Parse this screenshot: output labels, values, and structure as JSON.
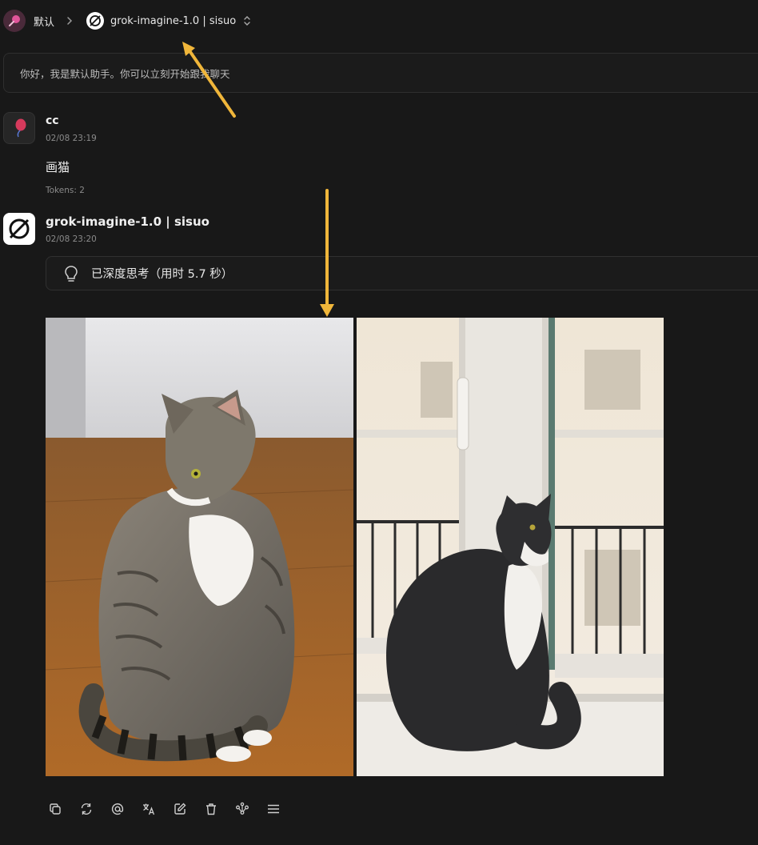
{
  "header": {
    "assistant_name": "默认",
    "model_name": "grok-imagine-1.0 | sisuo",
    "icons": [
      "assistant-avatar-icon",
      "chevron-right-icon",
      "grok-model-icon",
      "chevron-updown-icon"
    ]
  },
  "greeting": {
    "text": "你好，我是默认助手。你可以立刻开始跟我聊天"
  },
  "user_message": {
    "name": "cc",
    "time": "02/08 23:19",
    "text": "画猫",
    "tokens": "Tokens: 2"
  },
  "assistant_message": {
    "name": "grok-imagine-1.0 | sisuo",
    "time": "02/08 23:20",
    "thinking_label": "已深度思考（用时 5.7 秒）",
    "images": [
      {
        "subject": "tabby cat sitting on wooden floor"
      },
      {
        "subject": "black and white cat on windowsill"
      }
    ]
  },
  "toolbar": {
    "icons": [
      "copy-icon",
      "regenerate-icon",
      "mention-icon",
      "translate-icon",
      "edit-icon",
      "delete-icon",
      "branch-icon",
      "menu-icon"
    ]
  },
  "colors": {
    "background": "#181818",
    "annotation_arrow": "#f0b63a",
    "text_primary": "#f0f0f0",
    "text_muted": "#8a8a8a"
  }
}
